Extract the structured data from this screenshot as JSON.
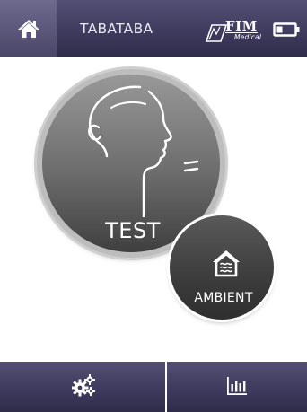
{
  "header": {
    "title": "TABATABA",
    "home_icon": "home-icon",
    "logo": {
      "name": "FIM",
      "sub": "Medical"
    },
    "battery_icon": "battery-icon"
  },
  "main": {
    "test_button": {
      "label": "TEST",
      "icon": "face-breath-icon"
    },
    "ambient_button": {
      "label": "AMBIENT",
      "icon": "house-air-icon"
    }
  },
  "footer": {
    "settings_icon": "gears-icon",
    "stats_icon": "bar-chart-icon"
  },
  "colors": {
    "bar_top": "#545075",
    "bar_bottom": "#2f2c4a",
    "test_circle": "#6d6d6d",
    "ambient_circle": "#3c3c3c"
  }
}
